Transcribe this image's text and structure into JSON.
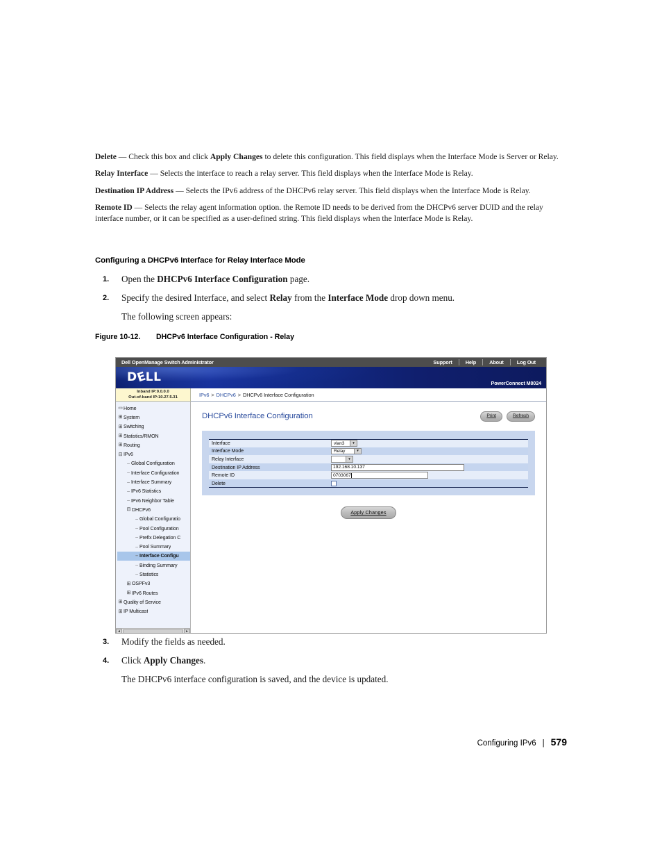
{
  "document": {
    "paragraphs": [
      {
        "id": "p-delete",
        "term": "Delete",
        "text": " — Check this box and click ",
        "bold2": "Apply Changes",
        "text2": " to delete this configuration. This field displays when the Interface Mode is Server or Relay."
      },
      {
        "id": "p-relay-interface",
        "term": "Relay Interface",
        "text": " — Selects the interface to reach a relay server. This field displays when the Interface Mode is Relay."
      },
      {
        "id": "p-dest-ip",
        "term": "Destination IP Address",
        "text": " — Selects the IPv6 address of the DHCPv6 relay server. This field displays when the Interface Mode is Relay."
      },
      {
        "id": "p-remote-id",
        "term": "Remote ID",
        "text": " — Selects the relay agent information option. the Remote ID needs to be derived from the DHCPv6 server DUID and the relay interface number, or it can be specified as a user-defined string. This field displays when the Interface Mode is Relay."
      }
    ],
    "section_heading": "Configuring a DHCPv6 Interface for Relay Interface Mode",
    "steps_before": [
      {
        "num": "1.",
        "pre": "Open the ",
        "bold": "DHCPv6 Interface Configuration",
        "post": " page."
      },
      {
        "num": "2.",
        "pre": "Specify the desired Interface, and select ",
        "bold": "Relay",
        "mid": " from the ",
        "bold2": "Interface Mode",
        "post": " drop down menu."
      }
    ],
    "substep_before": "The following screen appears:",
    "figure": {
      "number": "Figure 10-12.",
      "title": "DHCPv6 Interface Configuration - Relay"
    },
    "steps_after": [
      {
        "num": "3.",
        "pre": "Modify the fields as needed.",
        "bold": "",
        "post": ""
      },
      {
        "num": "4.",
        "pre": "Click ",
        "bold": "Apply Changes",
        "post": "."
      }
    ],
    "substep_after": "The DHCPv6 interface configuration is saved, and the device is updated.",
    "footer": {
      "chapter": "Configuring IPv6",
      "separator": "|",
      "page_number": "579"
    }
  },
  "app": {
    "titlebar": {
      "product": "Dell OpenManage Switch Administrator",
      "menu": [
        "Support",
        "Help",
        "About",
        "Log Out"
      ]
    },
    "logobar": {
      "logo_text": "DELL",
      "model": "PowerConnect M8024"
    },
    "ipbox": {
      "inband": "Inband IP:0.0.0.0",
      "outofband": "Out-of-band IP:10.27.5.31"
    },
    "breadcrumb": {
      "items": [
        "IPv6",
        "DHCPv6",
        "DHCPv6 Interface Configuration"
      ],
      "separator": ">"
    },
    "tree": [
      {
        "label": "Home",
        "level": 1,
        "marker": "screen",
        "selected": false
      },
      {
        "label": "System",
        "level": 1,
        "marker": "plus",
        "selected": false
      },
      {
        "label": "Switching",
        "level": 1,
        "marker": "plus",
        "selected": false
      },
      {
        "label": "Statistics/RMON",
        "level": 1,
        "marker": "plus",
        "selected": false
      },
      {
        "label": "Routing",
        "level": 1,
        "marker": "plus",
        "selected": false
      },
      {
        "label": "IPv6",
        "level": 1,
        "marker": "minus",
        "selected": false
      },
      {
        "label": "Global Configuration",
        "level": 2,
        "marker": "leaf",
        "selected": false
      },
      {
        "label": "Interface Configuration",
        "level": 2,
        "marker": "leaf",
        "selected": false
      },
      {
        "label": "Interface Summary",
        "level": 2,
        "marker": "leaf",
        "selected": false
      },
      {
        "label": "IPv6 Statistics",
        "level": 2,
        "marker": "leaf",
        "selected": false
      },
      {
        "label": "IPv6 Neighbor Table",
        "level": 2,
        "marker": "leaf",
        "selected": false
      },
      {
        "label": "DHCPv6",
        "level": 2,
        "marker": "minus",
        "selected": false
      },
      {
        "label": "Global Configuratio",
        "level": 3,
        "marker": "leaf",
        "selected": false
      },
      {
        "label": "Pool Configuration",
        "level": 3,
        "marker": "leaf",
        "selected": false
      },
      {
        "label": "Prefix Delegation C",
        "level": 3,
        "marker": "leaf",
        "selected": false
      },
      {
        "label": "Pool Summary",
        "level": 3,
        "marker": "leaf",
        "selected": false
      },
      {
        "label": "Interface Configu",
        "level": 3,
        "marker": "leaf",
        "selected": true
      },
      {
        "label": "Binding Summary",
        "level": 3,
        "marker": "leaf",
        "selected": false
      },
      {
        "label": "Statistics",
        "level": 3,
        "marker": "leaf",
        "selected": false
      },
      {
        "label": "OSPFv3",
        "level": 2,
        "marker": "plus",
        "selected": false
      },
      {
        "label": "IPv6 Routes",
        "level": 2,
        "marker": "plus",
        "selected": false
      },
      {
        "label": "Quality of Service",
        "level": 1,
        "marker": "plus",
        "selected": false
      },
      {
        "label": "IP Multicast",
        "level": 1,
        "marker": "plus",
        "selected": false
      }
    ],
    "panel": {
      "title": "DHCPv6 Interface Configuration",
      "print_label": "Print",
      "refresh_label": "Refresh",
      "apply_label": "Apply Changes"
    },
    "form": {
      "rows": [
        {
          "label": "Interface",
          "type": "select",
          "value": "vlan3"
        },
        {
          "label": "Interface Mode",
          "type": "select",
          "value": "Relay"
        },
        {
          "label": "Relay Interface",
          "type": "select",
          "value": ""
        },
        {
          "label": "Destination IP Address",
          "type": "text",
          "value": "192.168.10.137"
        },
        {
          "label": "Remote ID",
          "type": "text",
          "value": "0703067"
        },
        {
          "label": "Delete",
          "type": "checkbox",
          "value": ""
        }
      ]
    }
  }
}
